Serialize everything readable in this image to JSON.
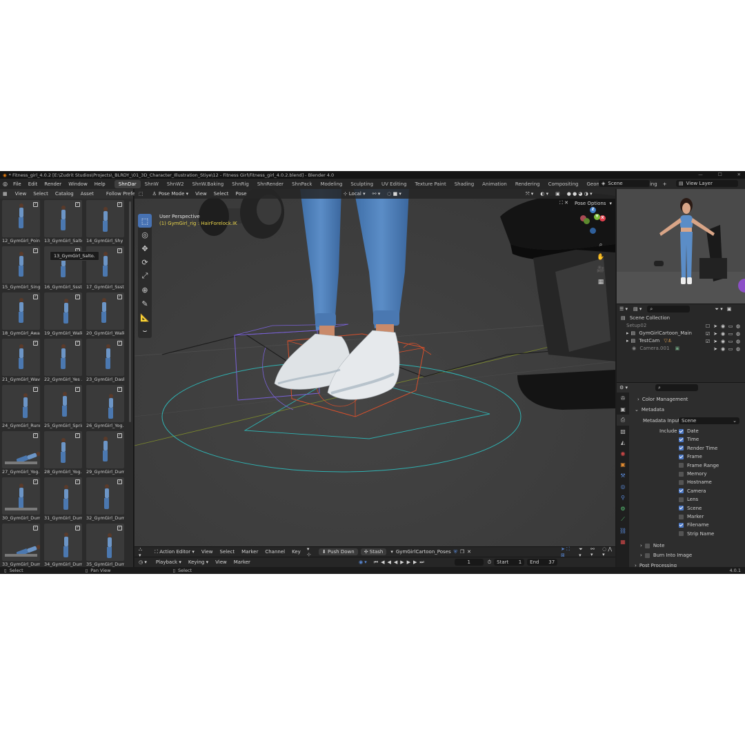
{
  "window": {
    "title": "* Fitness_girl_4.0.2 [E:\\Zudrit Studios\\Projects\\_BLRDY_\\01_3D_Character_Illustration_Stiye\\12 - Fitness Girl\\Fitness_girl_4.0.2.blend] - Blender 4.0"
  },
  "menu": [
    "File",
    "Edit",
    "Render",
    "Window",
    "Help"
  ],
  "workspaces": [
    {
      "label": "ShnDar",
      "active": true
    },
    {
      "label": "ShnW"
    },
    {
      "label": "ShnW2"
    },
    {
      "label": "ShnW.Baking"
    },
    {
      "label": "ShnRig"
    },
    {
      "label": "ShnRender"
    },
    {
      "label": "ShnPack"
    },
    {
      "label": "Modeling"
    },
    {
      "label": "Sculpting"
    },
    {
      "label": "UV Editing"
    },
    {
      "label": "Texture Paint"
    },
    {
      "label": "Shading"
    },
    {
      "label": "Animation"
    },
    {
      "label": "Rendering"
    },
    {
      "label": "Compositing"
    },
    {
      "label": "Geometry Nodes"
    },
    {
      "label": "Scripting"
    }
  ],
  "scene_field": "Scene",
  "view_layer_field": "View Layer",
  "asset_browser": {
    "menus": [
      "View",
      "Select",
      "Catalog",
      "Asset"
    ],
    "follow_prefs": "Follow Prefere",
    "tooltip": "13_GymGirl_Salto.",
    "assets": [
      "12_GymGirl_Poin...",
      "13_GymGirl_Salto",
      "14_GymGirl_Shy",
      "15_GymGirl_Singl...",
      "16_GymGirl_Ssst...",
      "17_GymGirl_Ssst...",
      "18_GymGirl_Awake",
      "19_GymGirl_Walk...",
      "20_GymGirl_Walk...",
      "21_GymGirl_Wavi...",
      "22_GymGirl_Yes ...",
      "23_GymGirl_Dash",
      "24_GymGirl_Runn...",
      "25_GymGirl_Sprint",
      "26_GymGirl_Yog...",
      "27_GymGirl_Yog...",
      "28_GymGirl_Yog...",
      "29_GymGirl_Dum...",
      "30_GymGirl_Dum...",
      "31_GymGirl_Dum...",
      "32_GymGirl_Dum...",
      "33_GymGirl_Dum...",
      "34_GymGirl_Dum...",
      "35_GymGirl_Dum..."
    ]
  },
  "viewport": {
    "mode": "Pose Mode",
    "menus": [
      "View",
      "Select",
      "Pose"
    ],
    "transform": "Local",
    "pose_options": "Pose Options",
    "perspective": "User Perspective",
    "active_object": "(1) GymGirl_rig : HairForelock.IK",
    "gizmo": {
      "x": "X",
      "y": "Y",
      "z": "Z"
    }
  },
  "outliner": {
    "root": "Scene Collection",
    "items": [
      {
        "label": "Setup02",
        "dim": true
      },
      {
        "label": "GymGirlCartoon_Main",
        "dim": false
      },
      {
        "label": "TestCam",
        "dim": false
      },
      {
        "label": "Camera.001",
        "dim": true
      }
    ]
  },
  "properties": {
    "color_management": "Color Management",
    "metadata": "Metadata",
    "metadata_input_label": "Metadata Input",
    "metadata_input_value": "Scene",
    "include_label": "Include",
    "include": [
      {
        "label": "Date",
        "on": true
      },
      {
        "label": "Time",
        "on": true
      },
      {
        "label": "Render Time",
        "on": true
      },
      {
        "label": "Frame",
        "on": true
      },
      {
        "label": "Frame Range",
        "on": false
      },
      {
        "label": "Memory",
        "on": false
      },
      {
        "label": "Hostname",
        "on": false
      },
      {
        "label": "Camera",
        "on": true
      },
      {
        "label": "Lens",
        "on": false
      },
      {
        "label": "Scene",
        "on": true
      },
      {
        "label": "Marker",
        "on": false
      },
      {
        "label": "Filename",
        "on": true
      },
      {
        "label": "Strip Name",
        "on": false
      }
    ],
    "note": "Note",
    "burn_into_image": "Burn Into Image",
    "post_processing": "Post Processing"
  },
  "action_editor": {
    "mode": "Action Editor",
    "menus": [
      "View",
      "Select",
      "Marker",
      "Channel",
      "Key"
    ],
    "push_down": "Push Down",
    "stash": "Stash",
    "action_name": "GymGirlCartoon_Poses"
  },
  "timeline": {
    "menus": [
      "Playback",
      "Keying",
      "View",
      "Marker"
    ],
    "current_frame": "1",
    "start_label": "Start",
    "start": "1",
    "end_label": "End",
    "end": "37"
  },
  "status": {
    "left": "Select",
    "middle": "Pan View",
    "right": "Select",
    "version": "4.0.1"
  },
  "colors": {
    "accent": "#4772b3",
    "axis_x": "#e2404e",
    "axis_y": "#7fbf3a",
    "axis_z": "#3d7cc9"
  }
}
